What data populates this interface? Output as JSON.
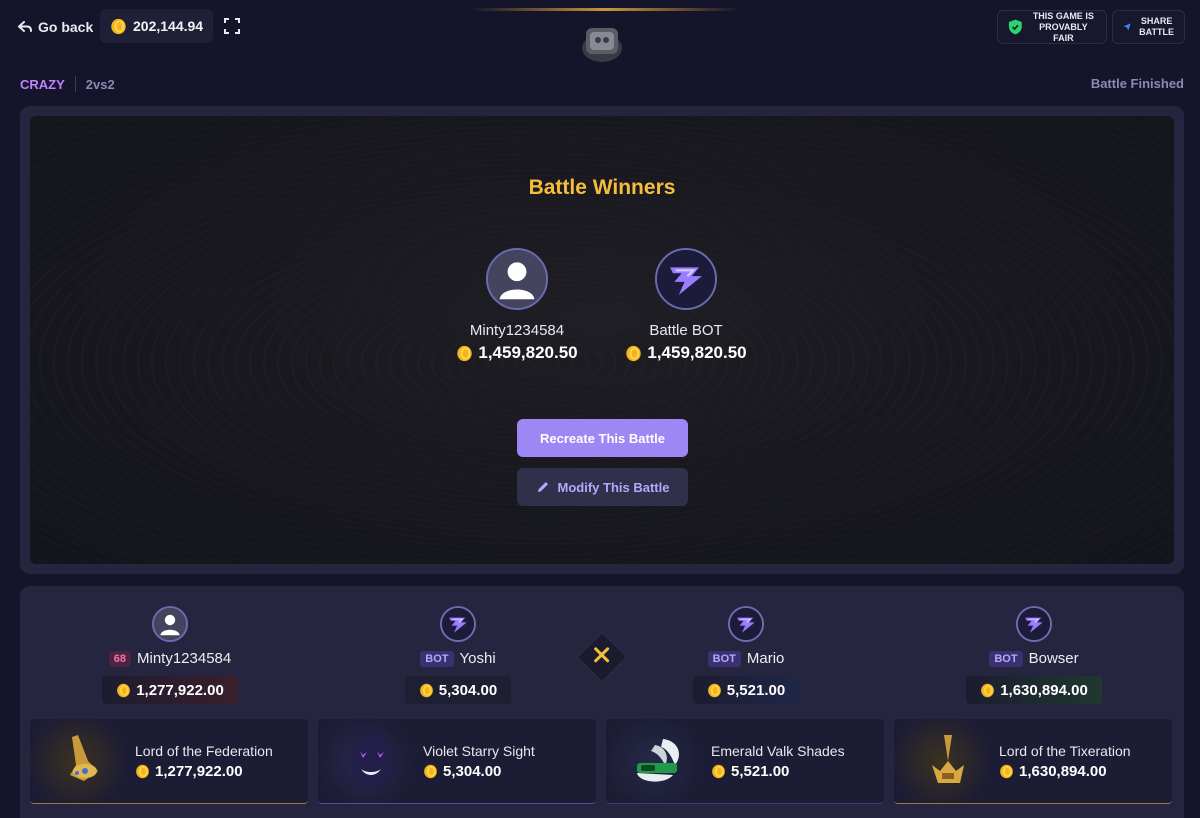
{
  "topbar": {
    "go_back_label": "Go back",
    "balance": "202,144.94",
    "fair_line1": "THIS GAME IS",
    "fair_line2": "PROVABLY FAIR",
    "share_line1": "SHARE",
    "share_line2": "BATTLE"
  },
  "mode": {
    "name": "CRAZY",
    "type": "2vs2",
    "status": "Battle Finished"
  },
  "winners": {
    "title": "Battle Winners",
    "list": [
      {
        "name": "Minty1234584",
        "amount": "1,459,820.50"
      },
      {
        "name": "Battle BOT",
        "amount": "1,459,820.50"
      }
    ],
    "recreate_label": "Recreate This Battle",
    "modify_label": "Modify This Battle"
  },
  "players": [
    {
      "tag": "68",
      "name": "Minty1234584",
      "total": "1,277,922.00",
      "item": "Lord of the Federation",
      "item_value": "1,277,922.00"
    },
    {
      "tag": "BOT",
      "name": "Yoshi",
      "total": "5,304.00",
      "item": "Violet Starry Sight",
      "item_value": "5,304.00"
    },
    {
      "tag": "BOT",
      "name": "Mario",
      "total": "5,521.00",
      "item": "Emerald Valk Shades",
      "item_value": "5,521.00"
    },
    {
      "tag": "BOT",
      "name": "Bowser",
      "total": "1,630,894.00",
      "item": "Lord of the Tixeration",
      "item_value": "1,630,894.00"
    }
  ],
  "colors": {
    "accent": "#9d87f5",
    "gold": "#f5bd3c",
    "background": "#14142a"
  }
}
